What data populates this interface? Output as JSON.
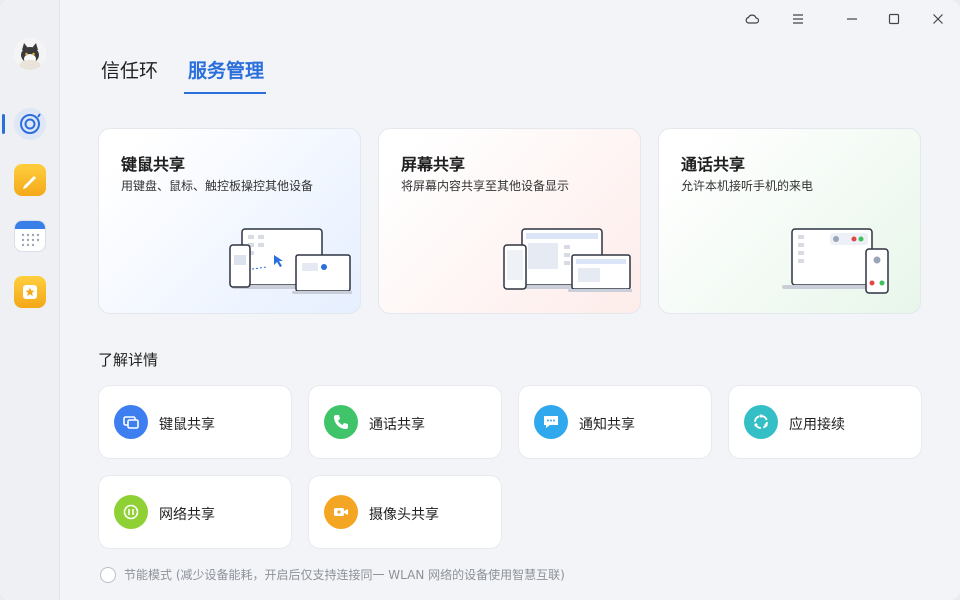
{
  "window": {
    "controls": {
      "cloud": "cloud-icon",
      "menu": "menu-icon",
      "minimize": "minimize-icon",
      "maximize": "maximize-icon",
      "close": "close-icon"
    }
  },
  "sidebar": {
    "items": [
      {
        "name": "sync-icon"
      },
      {
        "name": "notes-icon"
      },
      {
        "name": "calendar-icon"
      },
      {
        "name": "favorites-icon"
      }
    ]
  },
  "tabs": [
    {
      "label": "信任环"
    },
    {
      "label": "服务管理"
    }
  ],
  "feature_cards": [
    {
      "title": "键鼠共享",
      "subtitle": "用键盘、鼠标、触控板操控其他设备"
    },
    {
      "title": "屏幕共享",
      "subtitle": "将屏幕内容共享至其他设备显示"
    },
    {
      "title": "通话共享",
      "subtitle": "允许本机接听手机的来电"
    }
  ],
  "details": {
    "title": "了解详情",
    "items": [
      {
        "label": "键鼠共享",
        "icon": "keyboard-mouse-icon",
        "color": "#3d7ff0"
      },
      {
        "label": "通话共享",
        "icon": "phone-icon",
        "color": "#3fc46a"
      },
      {
        "label": "通知共享",
        "icon": "chat-bubble-icon",
        "color": "#2fa8ee"
      },
      {
        "label": "应用接续",
        "icon": "app-continue-icon",
        "color": "#34bfc7"
      },
      {
        "label": "网络共享",
        "icon": "network-share-icon",
        "color": "#8fd135"
      },
      {
        "label": "摄像头共享",
        "icon": "camera-icon",
        "color": "#f5a524"
      }
    ]
  },
  "footer": {
    "power_saving_label": "节能模式 (减少设备能耗，开启后仅支持连接同一 WLAN 网络的设备使用智慧互联)"
  },
  "colors": {
    "accent": "#2a6fdb"
  }
}
